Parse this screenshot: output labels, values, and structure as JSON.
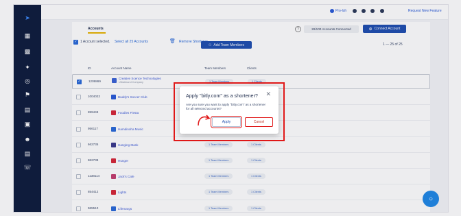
{
  "topbar": {
    "pro_label": "Pro-Ish",
    "request_feature": "Request New Feature"
  },
  "header": {
    "tab_accounts": "Accounts",
    "help": "?",
    "accounts_connected": "26/100 Accounts Connected",
    "connect_account": "Connect Account"
  },
  "toolbar": {
    "selected_text": "1 Account selected.",
    "select_all": "Select all 25 Accounts",
    "remove_shortener": "Remove Shortener",
    "add_team_members": "Add Team Members",
    "pagination": "1 — 25 of 25"
  },
  "table": {
    "headers": [
      "ID",
      "Account Name",
      "Team Members",
      "Clients"
    ],
    "rows": [
      {
        "id": "1209869",
        "name": "Creative Scence Technologies",
        "sub": "Uttrakhand Company",
        "team": "1 Team Members",
        "clients": "1 Clients",
        "color": "#3b63d6",
        "checked": true
      },
      {
        "id": "1004022",
        "name": "Buddy's Soccer Club",
        "sub": "",
        "team": "",
        "clients": "",
        "color": "#2a5bd7",
        "checked": false
      },
      {
        "id": "859449",
        "name": "Foodies Fiesta",
        "sub": "",
        "team": "",
        "clients": "",
        "color": "#d62839",
        "checked": false
      },
      {
        "id": "956117",
        "name": "Hamdinoha Music",
        "sub": "",
        "team": "",
        "clients": "",
        "color": "#2a6ad8",
        "checked": false
      },
      {
        "id": "662735",
        "name": "Hanging Mask",
        "sub": "",
        "team": "1 Team Members",
        "clients": "1 Clients",
        "color": "#3a3a8c",
        "checked": false
      },
      {
        "id": "862738",
        "name": "Hunger",
        "sub": "",
        "team": "1 Team Members",
        "clients": "1 Clients",
        "color": "#d62839",
        "checked": false
      },
      {
        "id": "1138114",
        "name": "Jack's Cafe",
        "sub": "",
        "team": "1 Team Members",
        "clients": "1 Clients",
        "color": "#c43e6f",
        "checked": false
      },
      {
        "id": "854412",
        "name": "Lights",
        "sub": "",
        "team": "1 Team Members",
        "clients": "1 Clients",
        "color": "#d62839",
        "checked": false
      },
      {
        "id": "965510",
        "name": "Lifemargs",
        "sub": "",
        "team": "1 Team Members",
        "clients": "1 Clients",
        "color": "#2a6ad8",
        "checked": false
      }
    ]
  },
  "modal": {
    "title": "Apply \"bitly.com\" as a shortener?",
    "body": "Are you sure you want to apply \"bitly.com\" as a shortener for all selected accounts?",
    "apply": "Apply",
    "cancel": "Cancel",
    "close": "✕"
  },
  "colors": {
    "sidebar": "#0f1d3d",
    "primary": "#1f4fb0",
    "annotation": "#e01818"
  }
}
